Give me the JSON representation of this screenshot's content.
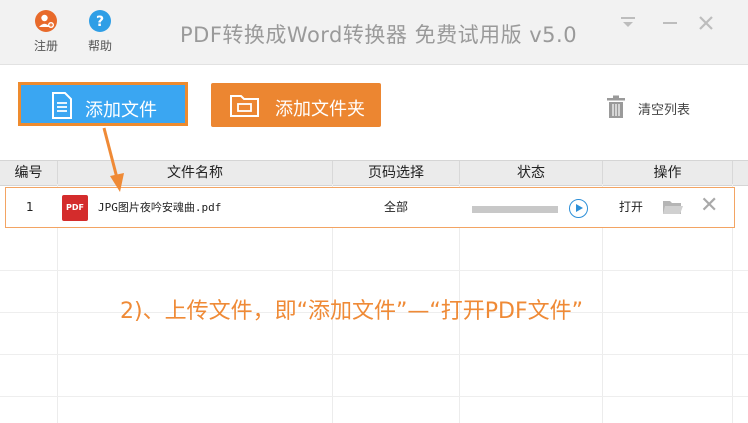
{
  "titlebar": {
    "register_label": "注册",
    "help_label": "帮助",
    "title": "PDF转换成Word转换器 免费试用版 v5.0"
  },
  "toolbar": {
    "add_file_label": "添加文件",
    "add_folder_label": "添加文件夹",
    "clear_list_label": "清空列表"
  },
  "table": {
    "headers": [
      "编号",
      "文件名称",
      "页码选择",
      "状态",
      "操作"
    ],
    "rows": [
      {
        "index": "1",
        "file_icon_text": "PDF",
        "file_name": "JPG图片夜吟安魂曲.pdf",
        "pages": "全部",
        "progress": 0,
        "open_label": "打开"
      }
    ]
  },
  "annotation": "2)、上传文件，即“添加文件”—“打开PDF文件”",
  "colors": {
    "add_file_bg": "#3aa6f2",
    "accent_orange": "#ec8631",
    "annotation": "#ef8a36"
  }
}
